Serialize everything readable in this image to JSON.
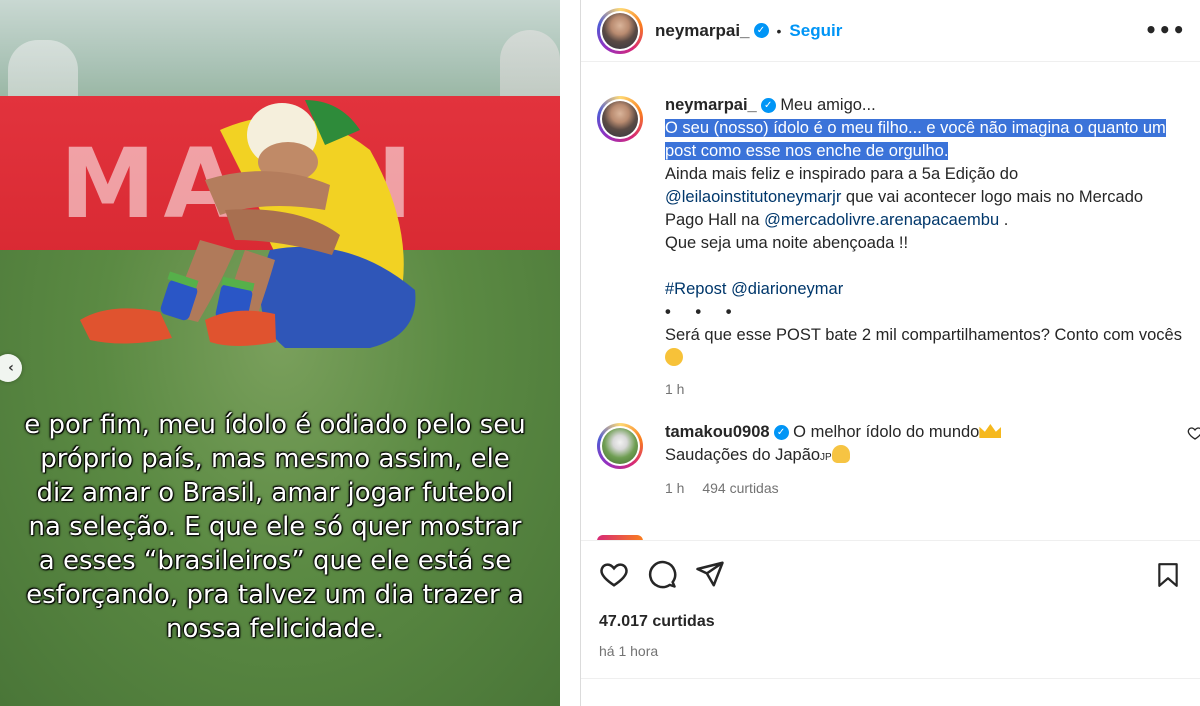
{
  "media": {
    "board_text": "MA   OI",
    "overlay_caption": "e por fim, meu ídolo é odiado pelo seu próprio país, mas mesmo assim, ele diz amar o Brasil, amar jogar futebol na seleção. E que ele só quer mostrar a esses “brasileiros” que ele está se esforçando, pra talvez um dia trazer a nossa felicidade.",
    "prev_icon": "chevron-left-icon"
  },
  "header": {
    "username": "neymarpai_",
    "verified_icon": "verified-badge-icon",
    "separator": "•",
    "follow_label": "Seguir",
    "more_icon": "more-options-icon"
  },
  "caption": {
    "username": "neymarpai_",
    "line1": "Meu amigo...",
    "highlight": "O seu (nosso) ídolo é o meu filho... e você não imagina o quanto um post como esse nos enche de orgulho.",
    "line3a": "Ainda mais feliz e inspirado para a 5a Edição do",
    "mention1": "@leilaoinstitutoneymarjr",
    "line3b": " que vai acontecer logo mais no Mercado Pago Hall na ",
    "mention2": "@mercadolivre.arenapacaembu",
    "line3c": " .",
    "line4": "Que seja uma noite abençoada !!",
    "hashtag": "#Repost",
    "mention3": "@diarioneymar",
    "dots": "• • •",
    "line5": "Será que esse POST bate 2 mil compartilhamentos? Conto com vocês",
    "time": "1 h"
  },
  "comment": {
    "username": "tamakou0908",
    "text": "O melhor ídolo do mundo",
    "line2": "Saudações do Japão",
    "jp": "JP",
    "time": "1 h",
    "likes": "494 curtidas"
  },
  "actions": {
    "likes": "47.017 curtidas",
    "when": "há 1 hora"
  },
  "colors": {
    "accent": "#0095f6",
    "highlight": "#3b73d9",
    "link": "#00376b",
    "muted": "#737373"
  }
}
